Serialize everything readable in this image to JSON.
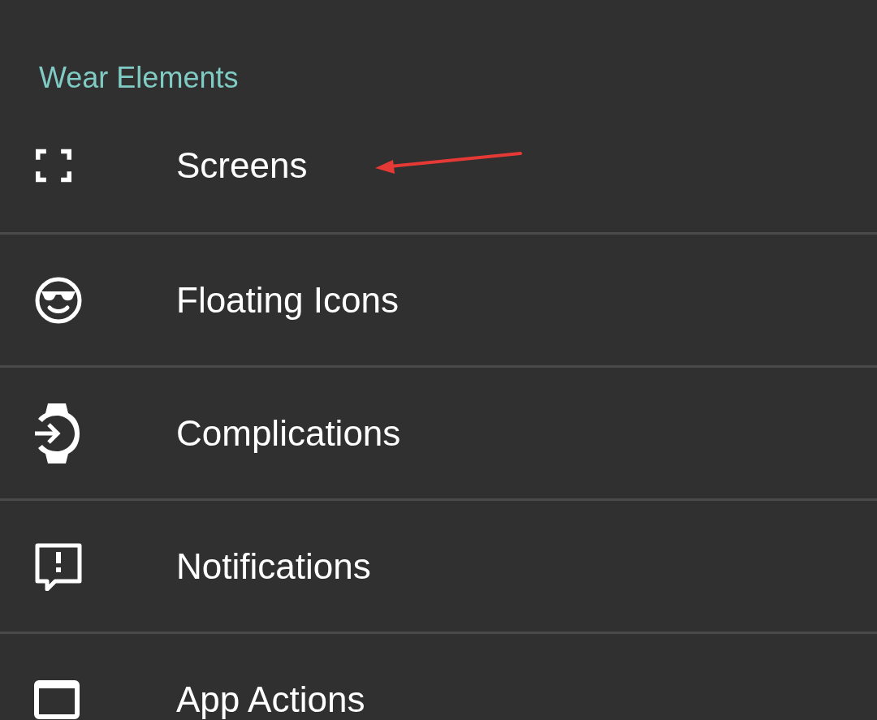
{
  "section": {
    "title": "Wear Elements"
  },
  "items": [
    {
      "kind": "fullscreen",
      "label": "Screens"
    },
    {
      "kind": "emoji",
      "label": "Floating Icons"
    },
    {
      "kind": "watch",
      "label": "Complications"
    },
    {
      "kind": "feedback",
      "label": "Notifications"
    },
    {
      "kind": "window",
      "label": "App Actions"
    }
  ],
  "annotation": {
    "kind": "arrow",
    "color": "#e53935"
  }
}
